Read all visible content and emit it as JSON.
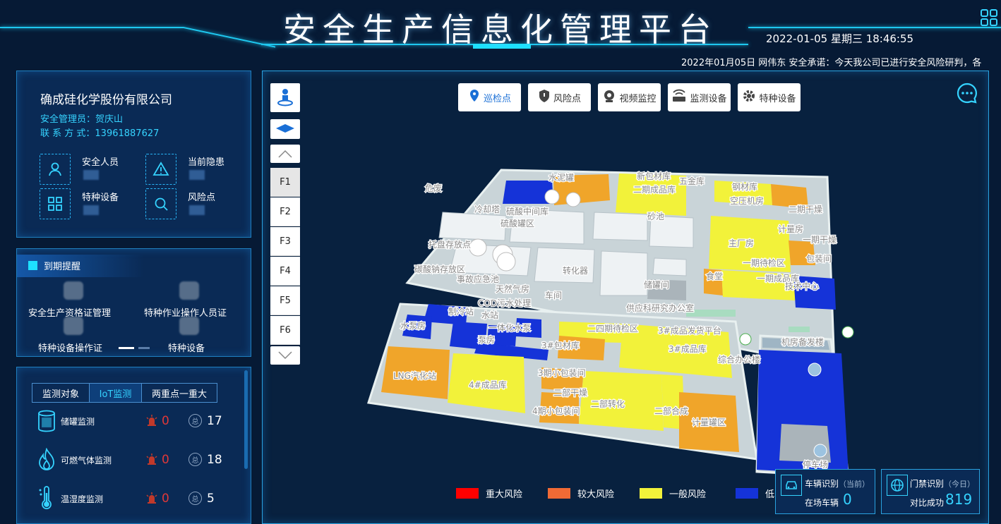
{
  "header": {
    "title": "安全生产信息化管理平台",
    "datetime": "2022-01-05 星期三 18:46:55",
    "marquee": "2022年01月05日 网伟东 安全承诺：今天我公司已进行安全风险研判，各"
  },
  "company": {
    "name": "确成硅化学股份有限公司",
    "manager_label": "安全管理员：",
    "manager": "贺庆山",
    "contact_label": "联 系 方 式：",
    "contact": "13961887627",
    "stats": [
      {
        "label": "安全人员",
        "icon": "person-icon"
      },
      {
        "label": "当前隐患",
        "icon": "warning-icon"
      },
      {
        "label": "特种设备",
        "icon": "grid-icon"
      },
      {
        "label": "风险点",
        "icon": "search-icon"
      }
    ]
  },
  "expiry": {
    "title": "到期提醒",
    "items": [
      "安全生产资格证管理",
      "特种作业操作人员证",
      "特种设备操作证",
      "特种设备"
    ]
  },
  "iot": {
    "tabs": [
      "监测对象",
      "IoT监测",
      "两重点一重大"
    ],
    "rows": [
      {
        "label": "储罐监测",
        "alarm": "0",
        "total": "17"
      },
      {
        "label": "可燃气体监测",
        "alarm": "0",
        "total": "18"
      },
      {
        "label": "温湿度监测",
        "alarm": "0",
        "total": "5"
      }
    ],
    "total_char": "总"
  },
  "map": {
    "toolbar": [
      "巡检点",
      "风险点",
      "视频监控",
      "监测设备",
      "特种设备"
    ],
    "floors": [
      "F1",
      "F2",
      "F3",
      "F4",
      "F5",
      "F6"
    ],
    "legend": [
      {
        "label": "重大风险",
        "color": "#ff0000"
      },
      {
        "label": "较大风险",
        "color": "#f06a35"
      },
      {
        "label": "一般风险",
        "color": "#f2f23a"
      },
      {
        "label": "低",
        "color": "#1533d8"
      }
    ],
    "buildings": [
      "新包材库",
      "二期成品库",
      "五金库",
      "钢材库",
      "空压机房",
      "二期干燥",
      "计量房",
      "一期干燥",
      "主厂房",
      "包装间",
      "食堂",
      "一期待检区",
      "一期成品库",
      "技术中心",
      "砂池",
      "硫酸中间库",
      "硫酸罐区",
      "托盘存放点",
      "碳酸钠存放区",
      "事故应急池",
      "天然气房",
      "转化器",
      "车间",
      "供应科研究办公室",
      "水泵房",
      "制冷站",
      "COD污水处理",
      "水站",
      "一体化水泵",
      "泵房",
      "二四期待检区",
      "3#成品发货平台",
      "3#成品库",
      "3#包材库",
      "综合办公楼",
      "机房备发楼",
      "LNG汽化站",
      "4#成品库",
      "3期小包装间",
      "二部干燥",
      "4期小包装间",
      "二部转化",
      "二部合成",
      "计量罐区",
      "停车场",
      "水泥罐",
      "冷却塔",
      "储罐间",
      "危废"
    ]
  },
  "recognition": {
    "vehicle_title": "车辆识别",
    "vehicle_sub": "（当前）",
    "vehicle_label": "在场车辆",
    "vehicle_value": "0",
    "gate_title": "门禁识别",
    "gate_sub": "（今日）",
    "gate_label": "对比成功",
    "gate_value": "819"
  }
}
